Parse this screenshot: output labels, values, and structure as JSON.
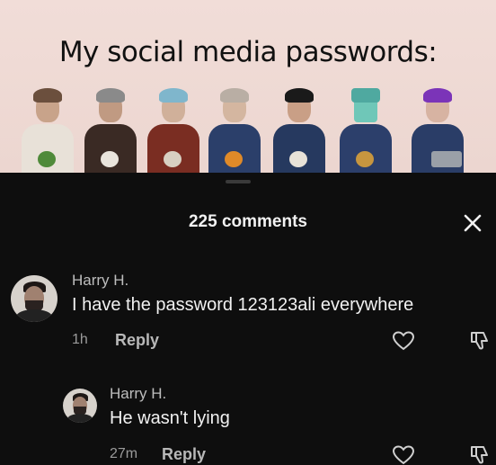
{
  "meme": {
    "title": "My social media passwords:"
  },
  "comments_panel": {
    "title": "225 comments",
    "comments": [
      {
        "username": "Harry H.",
        "text": "I have the password 123123ali everywhere",
        "time": "1h",
        "reply_label": "Reply"
      },
      {
        "username": "Harry H.",
        "text": "He wasn't lying",
        "time": "27m",
        "reply_label": "Reply"
      }
    ]
  },
  "colors": {
    "sheet_background": "#0e0e0e",
    "meme_background": "#f1ddd8",
    "text_primary": "#f1f1f1",
    "text_secondary": "#bdbdbd"
  },
  "icons": {
    "close": "close-icon",
    "like": "heart-icon",
    "dislike": "dislike-icon"
  }
}
